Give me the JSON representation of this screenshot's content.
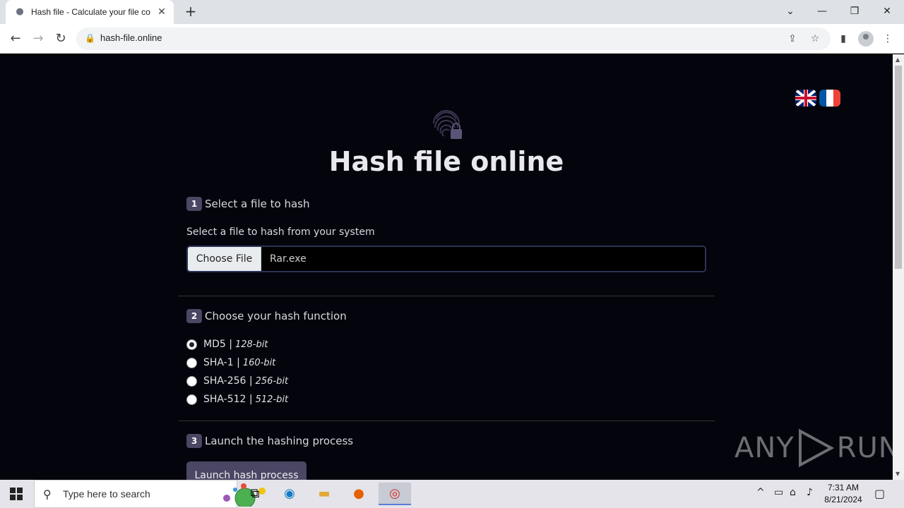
{
  "browser": {
    "tab_title": "Hash file - Calculate your file co",
    "tab_close": "✕",
    "new_tab": "+",
    "url": "hash-file.online",
    "window_controls": [
      "⌄",
      "—",
      "❐",
      "✕"
    ]
  },
  "page": {
    "title": "Hash file online",
    "step1": {
      "number": "1",
      "label": "Select a file to hash",
      "help": "Select a file to hash from your system",
      "choose_button": "Choose File",
      "file_name": "Rar.exe"
    },
    "step2": {
      "number": "2",
      "label": "Choose your hash function",
      "options": [
        {
          "name": "MD5 |",
          "bits": "128-bit",
          "checked": true
        },
        {
          "name": "SHA-1 |",
          "bits": "160-bit",
          "checked": false
        },
        {
          "name": "SHA-256 |",
          "bits": "256-bit",
          "checked": false
        },
        {
          "name": "SHA-512 |",
          "bits": "512-bit",
          "checked": false
        }
      ]
    },
    "step3": {
      "number": "3",
      "label": "Launch the hashing process",
      "button": "Launch hash process"
    },
    "languages": [
      "English",
      "Français"
    ]
  },
  "watermark": {
    "left": "ANY",
    "right": "RUN"
  },
  "taskbar": {
    "search_placeholder": "Type here to search",
    "time": "7:31 AM",
    "date": "8/21/2024"
  },
  "colors": {
    "page_bg": "#04040c",
    "accent": "#4b4664"
  }
}
